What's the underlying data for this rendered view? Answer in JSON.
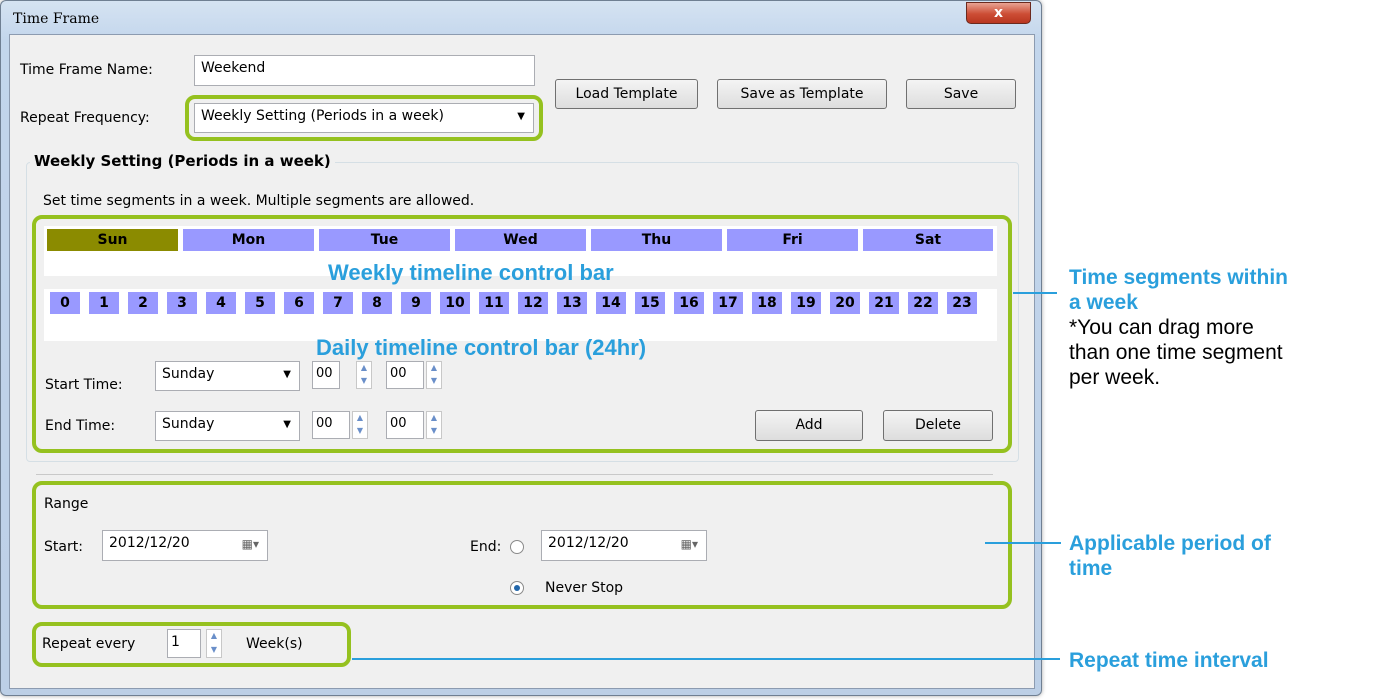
{
  "window": {
    "title": "Time Frame",
    "close_label": "x"
  },
  "form": {
    "name_label": "Time Frame Name:",
    "name_value": "Weekend",
    "repeat_label": "Repeat Frequency:",
    "repeat_value": "Weekly Setting (Periods in a week)",
    "load_template": "Load Template",
    "save_template": "Save as Template",
    "save": "Save"
  },
  "weekly": {
    "group_title": "Weekly Setting (Periods in a week)",
    "hint": "Set time segments in a week. Multiple segments are allowed.",
    "days": [
      "Sun",
      "Mon",
      "Tue",
      "Wed",
      "Thu",
      "Fri",
      "Sat"
    ],
    "active_day": "Sun",
    "hours": [
      "0",
      "1",
      "2",
      "3",
      "4",
      "5",
      "6",
      "7",
      "8",
      "9",
      "10",
      "11",
      "12",
      "13",
      "14",
      "15",
      "16",
      "17",
      "18",
      "19",
      "20",
      "21",
      "22",
      "23"
    ],
    "start_label": "Start Time:",
    "start_day": "Sunday",
    "start_hour": "00",
    "start_min": "00",
    "end_label": "End Time:",
    "end_day": "Sunday",
    "end_hour": "00",
    "end_min": "00",
    "add": "Add",
    "delete": "Delete"
  },
  "range": {
    "title": "Range",
    "start_label": "Start:",
    "start_value": "2012/12/20",
    "end_label": "End:",
    "end_value": "2012/12/20",
    "never_stop": "Never Stop",
    "selected": "Never Stop"
  },
  "repeat": {
    "prefix": "Repeat every",
    "value": "1",
    "unit": "Week(s)"
  },
  "annotations": {
    "weekly_bar": "Weekly timeline control bar",
    "daily_bar": "Daily timeline control bar (24hr)",
    "segments_title_1": "Time segments within",
    "segments_title_2": "a week",
    "segments_note_1": "*You can drag more",
    "segments_note_2": "than one time segment",
    "segments_note_3": "per week.",
    "period_1": "Applicable period of",
    "period_2": "time",
    "interval": "Repeat time interval",
    "highlight_color": "#95c11f",
    "callout_color": "#2a9fdc"
  }
}
